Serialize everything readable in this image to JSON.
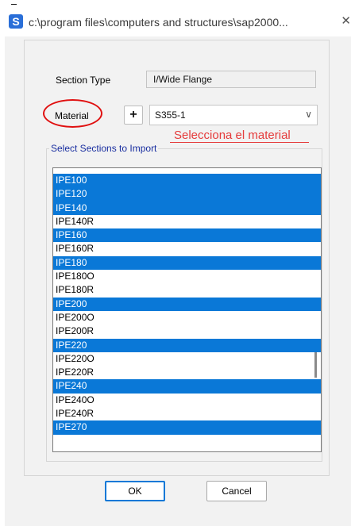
{
  "window": {
    "title": "c:\\program files\\computers and structures\\sap2000...",
    "app_icon_letter": "S",
    "close_glyph": "✕"
  },
  "form": {
    "section_type_label": "Section Type",
    "section_type_value": "I/Wide Flange",
    "material_label": "Material",
    "add_button_label": "+",
    "material_value": "S355-1",
    "annotation": "Selecciona el material"
  },
  "import": {
    "legend": "Select Sections to Import",
    "items": [
      {
        "label": "IPE100",
        "selected": true
      },
      {
        "label": "IPE120",
        "selected": true
      },
      {
        "label": "IPE140",
        "selected": true
      },
      {
        "label": "IPE140R",
        "selected": false
      },
      {
        "label": "IPE160",
        "selected": true
      },
      {
        "label": "IPE160R",
        "selected": false
      },
      {
        "label": "IPE180",
        "selected": true
      },
      {
        "label": "IPE180O",
        "selected": false
      },
      {
        "label": "IPE180R",
        "selected": false
      },
      {
        "label": "IPE200",
        "selected": true
      },
      {
        "label": "IPE200O",
        "selected": false
      },
      {
        "label": "IPE200R",
        "selected": false
      },
      {
        "label": "IPE220",
        "selected": true
      },
      {
        "label": "IPE220O",
        "selected": false
      },
      {
        "label": "IPE220R",
        "selected": false
      },
      {
        "label": "IPE240",
        "selected": true
      },
      {
        "label": "IPE240O",
        "selected": false
      },
      {
        "label": "IPE240R",
        "selected": false
      },
      {
        "label": "IPE270",
        "selected": true
      }
    ]
  },
  "buttons": {
    "ok": "OK",
    "cancel": "Cancel"
  },
  "colors": {
    "selection": "#0a78d7",
    "annotation": "#e53b3b",
    "highlight_ellipse": "#e01010",
    "legend_text": "#1a2fa0"
  }
}
